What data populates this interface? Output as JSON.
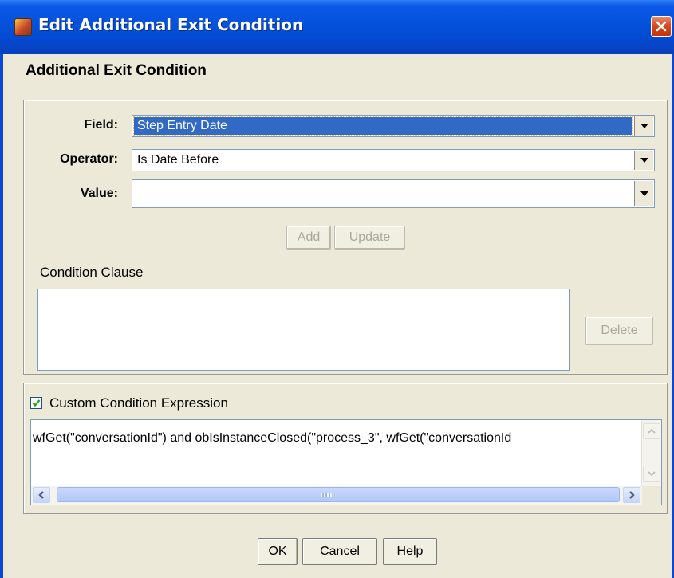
{
  "window": {
    "title": "Edit Additional Exit Condition"
  },
  "heading": "Additional Exit Condition",
  "form": {
    "field_label": "Field:",
    "field_value": "Step Entry Date",
    "operator_label": "Operator:",
    "operator_value": "Is Date Before",
    "value_label": "Value:",
    "value_value": ""
  },
  "buttons": {
    "add": "Add",
    "update": "Update",
    "delete": "Delete",
    "ok": "OK",
    "cancel": "Cancel",
    "help": "Help"
  },
  "condition_clause": {
    "label": "Condition Clause",
    "content": ""
  },
  "custom": {
    "checkbox_checked": true,
    "checkbox_label": "Custom Condition Expression",
    "expression": "wfGet(\"conversationId\") and obIsInstanceClosed(\"process_3\", wfGet(\"conversationId"
  },
  "icons": [
    "app-icon",
    "close-icon",
    "chevron-down-icon",
    "checkmark-icon",
    "scroll-left-icon",
    "scroll-right-icon",
    "scroll-up-icon",
    "scroll-down-icon"
  ],
  "colors": {
    "titlebar": "#0553dc",
    "dialog_bg": "#ece9d8",
    "selection": "#316ac5",
    "close_button": "#d8491f"
  }
}
